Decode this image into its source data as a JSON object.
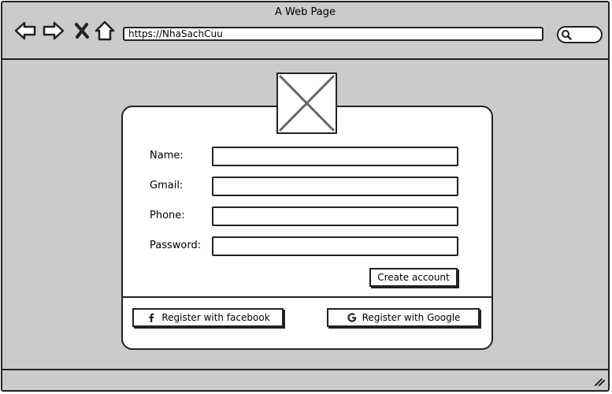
{
  "window": {
    "title": "A Web Page",
    "url": "https://NhaSachCuu"
  },
  "form": {
    "fields": [
      {
        "label": "Name:",
        "value": ""
      },
      {
        "label": "Gmail:",
        "value": ""
      },
      {
        "label": "Phone:",
        "value": ""
      },
      {
        "label": "Password:",
        "value": ""
      }
    ],
    "create_label": "Create account",
    "facebook_label": "Register with facebook",
    "google_label": "Register with Google"
  },
  "icons": {
    "back": "back-arrow-icon",
    "forward": "forward-arrow-icon",
    "stop": "close-icon",
    "home": "home-icon",
    "search": "search-icon",
    "image": "image-placeholder-icon",
    "facebook": "facebook-icon",
    "google": "google-icon",
    "resize": "resize-grip-icon"
  }
}
